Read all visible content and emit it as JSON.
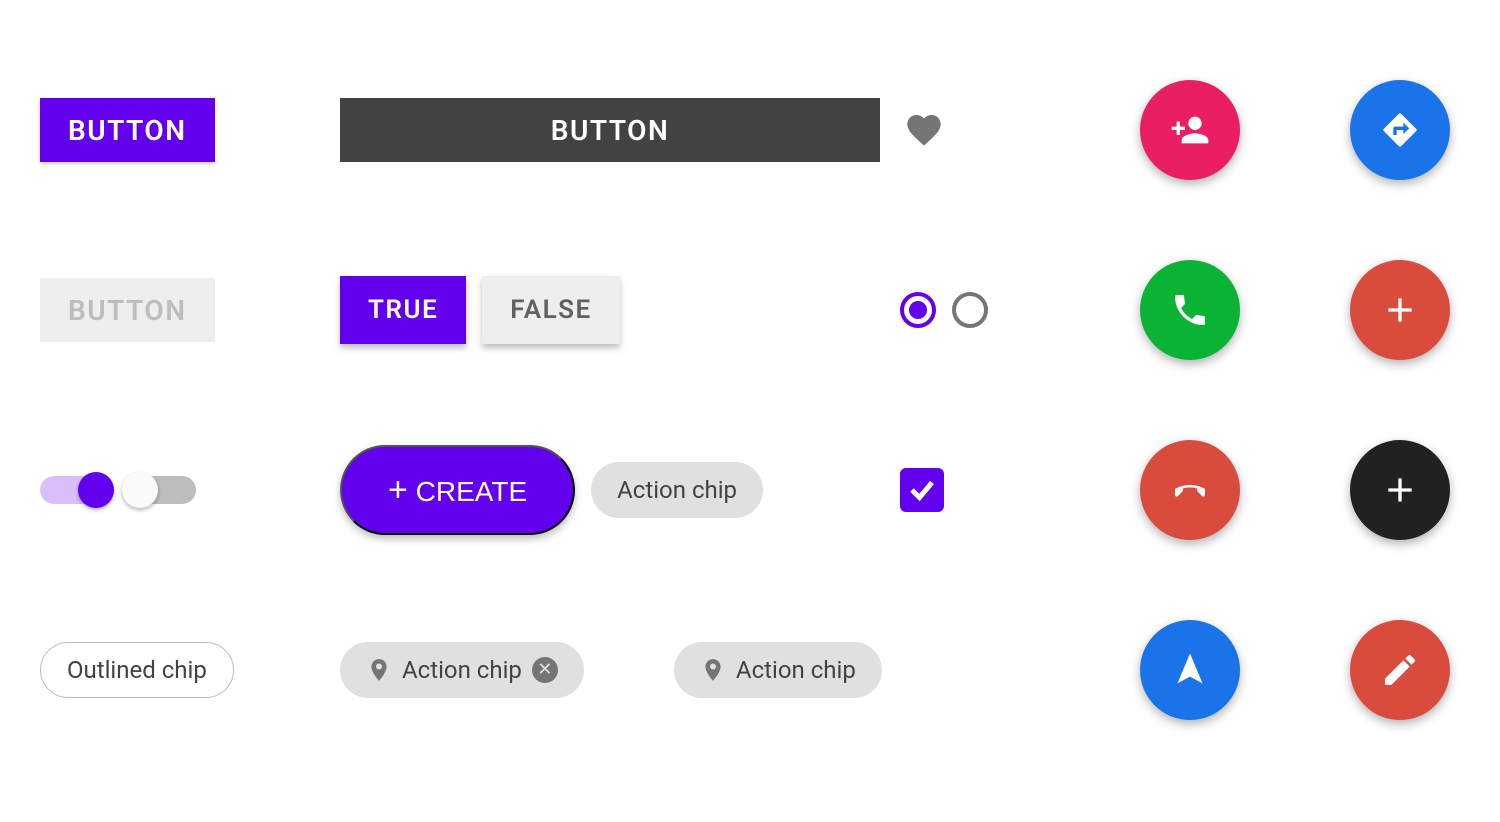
{
  "row1": {
    "button_primary": "BUTTON",
    "button_dark": "BUTTON"
  },
  "row2": {
    "button_disabled": "BUTTON",
    "toggle_true": "TRUE",
    "toggle_false": "FALSE"
  },
  "row3": {
    "create_label": "CREATE",
    "action_chip": "Action chip"
  },
  "row4": {
    "outlined_chip": "Outlined chip",
    "action_chip_closable": "Action chip",
    "action_chip_pin": "Action chip"
  },
  "fabs": {
    "person_add": "person-add-icon",
    "directions": "directions-icon",
    "phone": "phone-icon",
    "plus_red": "plus-icon",
    "hangup": "hangup-icon",
    "plus_black": "plus-icon",
    "navigate": "navigate-icon",
    "edit": "edit-icon"
  },
  "colors": {
    "primary": "#6200EE",
    "pink": "#e91e63",
    "blue": "#1a73e8",
    "green": "#0bb335",
    "red": "#d94c3d",
    "black": "#212121"
  }
}
